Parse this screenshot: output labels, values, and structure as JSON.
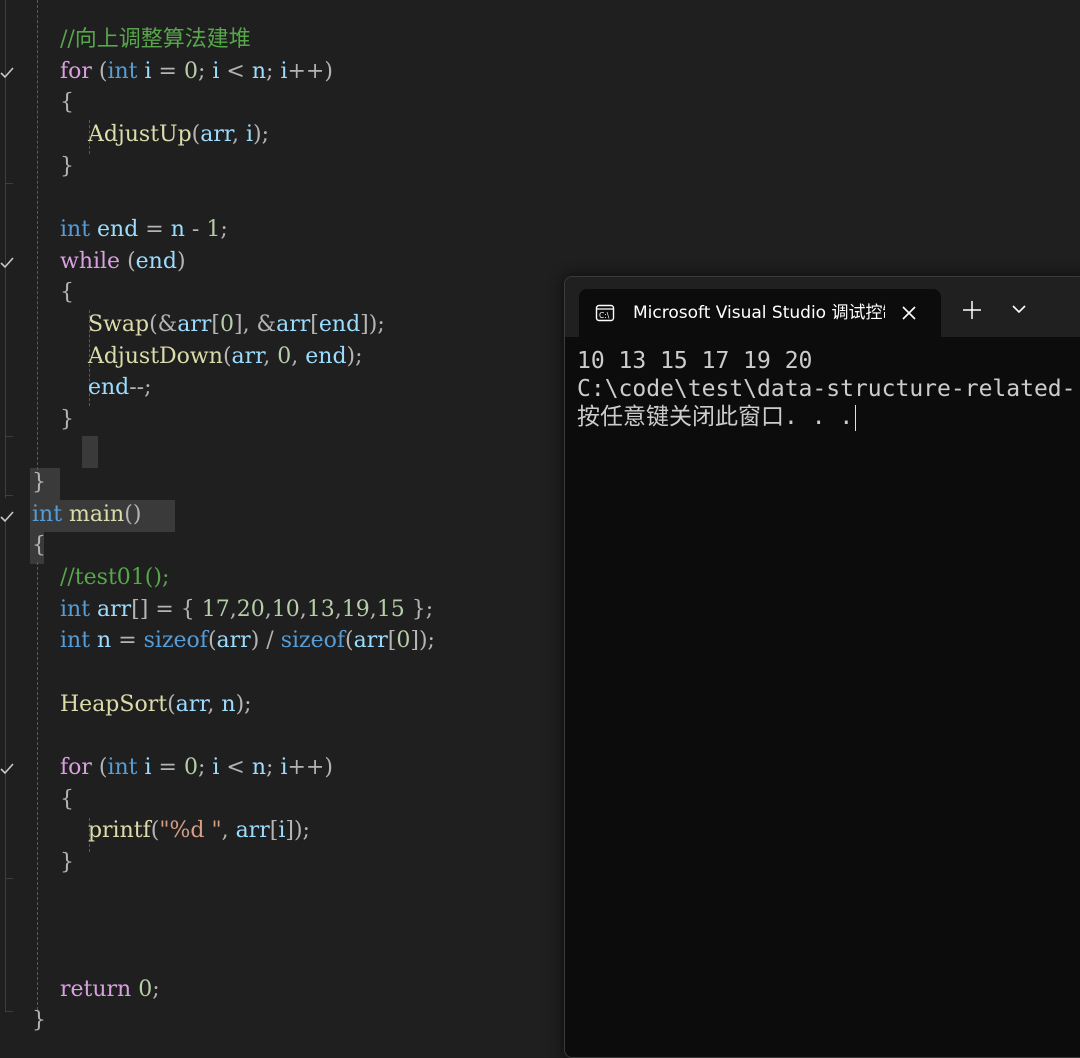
{
  "editor": {
    "lines": [
      [
        {
          "t": "    ",
          "c": "p"
        },
        {
          "t": "//向上调整算法建堆",
          "c": "cm"
        }
      ],
      [
        {
          "t": "    ",
          "c": "p"
        },
        {
          "t": "for",
          "c": "ctrl"
        },
        {
          "t": " (",
          "c": "p"
        },
        {
          "t": "int",
          "c": "kw"
        },
        {
          "t": " ",
          "c": "p"
        },
        {
          "t": "i",
          "c": "var"
        },
        {
          "t": " = ",
          "c": "p"
        },
        {
          "t": "0",
          "c": "num"
        },
        {
          "t": "; ",
          "c": "p"
        },
        {
          "t": "i",
          "c": "var"
        },
        {
          "t": " < ",
          "c": "p"
        },
        {
          "t": "n",
          "c": "var"
        },
        {
          "t": "; ",
          "c": "p"
        },
        {
          "t": "i",
          "c": "var"
        },
        {
          "t": "++)",
          "c": "p"
        }
      ],
      [
        {
          "t": "    {",
          "c": "p"
        }
      ],
      [
        {
          "t": "        ",
          "c": "p"
        },
        {
          "t": "AdjustUp",
          "c": "fn"
        },
        {
          "t": "(",
          "c": "p"
        },
        {
          "t": "arr",
          "c": "var"
        },
        {
          "t": ", ",
          "c": "p"
        },
        {
          "t": "i",
          "c": "var"
        },
        {
          "t": ");",
          "c": "p"
        }
      ],
      [
        {
          "t": "    }",
          "c": "p"
        }
      ],
      [
        {
          "t": "",
          "c": "p"
        }
      ],
      [
        {
          "t": "    ",
          "c": "p"
        },
        {
          "t": "int",
          "c": "kw"
        },
        {
          "t": " ",
          "c": "p"
        },
        {
          "t": "end",
          "c": "var"
        },
        {
          "t": " = ",
          "c": "p"
        },
        {
          "t": "n",
          "c": "var"
        },
        {
          "t": " - ",
          "c": "p"
        },
        {
          "t": "1",
          "c": "num"
        },
        {
          "t": ";",
          "c": "p"
        }
      ],
      [
        {
          "t": "    ",
          "c": "p"
        },
        {
          "t": "while",
          "c": "ctrl"
        },
        {
          "t": " (",
          "c": "p"
        },
        {
          "t": "end",
          "c": "var"
        },
        {
          "t": ")",
          "c": "p"
        }
      ],
      [
        {
          "t": "    {",
          "c": "p"
        }
      ],
      [
        {
          "t": "        ",
          "c": "p"
        },
        {
          "t": "Swap",
          "c": "fn"
        },
        {
          "t": "(&",
          "c": "p"
        },
        {
          "t": "arr",
          "c": "var"
        },
        {
          "t": "[",
          "c": "p"
        },
        {
          "t": "0",
          "c": "num"
        },
        {
          "t": "], &",
          "c": "p"
        },
        {
          "t": "arr",
          "c": "var"
        },
        {
          "t": "[",
          "c": "p"
        },
        {
          "t": "end",
          "c": "var"
        },
        {
          "t": "]);",
          "c": "p"
        }
      ],
      [
        {
          "t": "        ",
          "c": "p"
        },
        {
          "t": "AdjustDown",
          "c": "fn"
        },
        {
          "t": "(",
          "c": "p"
        },
        {
          "t": "arr",
          "c": "var"
        },
        {
          "t": ", ",
          "c": "p"
        },
        {
          "t": "0",
          "c": "num"
        },
        {
          "t": ", ",
          "c": "p"
        },
        {
          "t": "end",
          "c": "var"
        },
        {
          "t": ");",
          "c": "p"
        }
      ],
      [
        {
          "t": "        ",
          "c": "p"
        },
        {
          "t": "end",
          "c": "var"
        },
        {
          "t": "--;",
          "c": "p"
        }
      ],
      [
        {
          "t": "    }",
          "c": "p"
        }
      ],
      [
        {
          "t": "",
          "c": "p"
        }
      ],
      [
        {
          "t": "}",
          "c": "p"
        }
      ],
      [
        {
          "t": "int",
          "c": "kw"
        },
        {
          "t": " ",
          "c": "p"
        },
        {
          "t": "main",
          "c": "fn"
        },
        {
          "t": "()",
          "c": "p"
        }
      ],
      [
        {
          "t": "{",
          "c": "p"
        }
      ],
      [
        {
          "t": "    ",
          "c": "p"
        },
        {
          "t": "//test01();",
          "c": "cm"
        }
      ],
      [
        {
          "t": "    ",
          "c": "p"
        },
        {
          "t": "int",
          "c": "kw"
        },
        {
          "t": " ",
          "c": "p"
        },
        {
          "t": "arr",
          "c": "var"
        },
        {
          "t": "[] = { ",
          "c": "p"
        },
        {
          "t": "17",
          "c": "num"
        },
        {
          "t": ",",
          "c": "p"
        },
        {
          "t": "20",
          "c": "num"
        },
        {
          "t": ",",
          "c": "p"
        },
        {
          "t": "10",
          "c": "num"
        },
        {
          "t": ",",
          "c": "p"
        },
        {
          "t": "13",
          "c": "num"
        },
        {
          "t": ",",
          "c": "p"
        },
        {
          "t": "19",
          "c": "num"
        },
        {
          "t": ",",
          "c": "p"
        },
        {
          "t": "15",
          "c": "num"
        },
        {
          "t": " };",
          "c": "p"
        }
      ],
      [
        {
          "t": "    ",
          "c": "p"
        },
        {
          "t": "int",
          "c": "kw"
        },
        {
          "t": " ",
          "c": "p"
        },
        {
          "t": "n",
          "c": "var"
        },
        {
          "t": " = ",
          "c": "p"
        },
        {
          "t": "sizeof",
          "c": "kw"
        },
        {
          "t": "(",
          "c": "p"
        },
        {
          "t": "arr",
          "c": "var"
        },
        {
          "t": ") / ",
          "c": "p"
        },
        {
          "t": "sizeof",
          "c": "kw"
        },
        {
          "t": "(",
          "c": "p"
        },
        {
          "t": "arr",
          "c": "var"
        },
        {
          "t": "[",
          "c": "p"
        },
        {
          "t": "0",
          "c": "num"
        },
        {
          "t": "]);",
          "c": "p"
        }
      ],
      [
        {
          "t": "",
          "c": "p"
        }
      ],
      [
        {
          "t": "    ",
          "c": "p"
        },
        {
          "t": "HeapSort",
          "c": "fn"
        },
        {
          "t": "(",
          "c": "p"
        },
        {
          "t": "arr",
          "c": "var"
        },
        {
          "t": ", ",
          "c": "p"
        },
        {
          "t": "n",
          "c": "var"
        },
        {
          "t": ");",
          "c": "p"
        }
      ],
      [
        {
          "t": "",
          "c": "p"
        }
      ],
      [
        {
          "t": "    ",
          "c": "p"
        },
        {
          "t": "for",
          "c": "ctrl"
        },
        {
          "t": " (",
          "c": "p"
        },
        {
          "t": "int",
          "c": "kw"
        },
        {
          "t": " ",
          "c": "p"
        },
        {
          "t": "i",
          "c": "var"
        },
        {
          "t": " = ",
          "c": "p"
        },
        {
          "t": "0",
          "c": "num"
        },
        {
          "t": "; ",
          "c": "p"
        },
        {
          "t": "i",
          "c": "var"
        },
        {
          "t": " < ",
          "c": "p"
        },
        {
          "t": "n",
          "c": "var"
        },
        {
          "t": "; ",
          "c": "p"
        },
        {
          "t": "i",
          "c": "var"
        },
        {
          "t": "++)",
          "c": "p"
        }
      ],
      [
        {
          "t": "    {",
          "c": "p"
        }
      ],
      [
        {
          "t": "        ",
          "c": "p"
        },
        {
          "t": "printf",
          "c": "fn"
        },
        {
          "t": "(",
          "c": "p"
        },
        {
          "t": "\"%d \"",
          "c": "str"
        },
        {
          "t": ", ",
          "c": "p"
        },
        {
          "t": "arr",
          "c": "var"
        },
        {
          "t": "[",
          "c": "p"
        },
        {
          "t": "i",
          "c": "var"
        },
        {
          "t": "]);",
          "c": "p"
        }
      ],
      [
        {
          "t": "    }",
          "c": "p"
        }
      ],
      [
        {
          "t": "",
          "c": "p"
        }
      ],
      [
        {
          "t": "",
          "c": "p"
        }
      ],
      [
        {
          "t": "",
          "c": "p"
        }
      ],
      [
        {
          "t": "    ",
          "c": "p"
        },
        {
          "t": "return",
          "c": "ctrl"
        },
        {
          "t": " ",
          "c": "p"
        },
        {
          "t": "0",
          "c": "num"
        },
        {
          "t": ";",
          "c": "p"
        }
      ],
      [
        {
          "t": "}",
          "c": "p"
        }
      ]
    ]
  },
  "terminal": {
    "tab_title": "Microsoft Visual Studio 调试控制台",
    "tab_icon": "terminal-app-icon",
    "close_icon": "close-icon",
    "new_tab_icon": "plus-icon",
    "dropdown_icon": "chevron-down-icon",
    "output_line_1": "10 13 15 17 19 20",
    "output_line_2": "C:\\code\\test\\data-structure-related-",
    "output_line_3": "按任意键关闭此窗口. . ."
  },
  "colors": {
    "keyword": "#569cd6",
    "control": "#d8a0df",
    "function": "#dcdcaa",
    "variable": "#9cdcfe",
    "number": "#b5cea8",
    "string": "#d69d85",
    "comment": "#57a64a",
    "editor_bg": "#1f1f1f",
    "terminal_bg": "#0c0c0c"
  }
}
